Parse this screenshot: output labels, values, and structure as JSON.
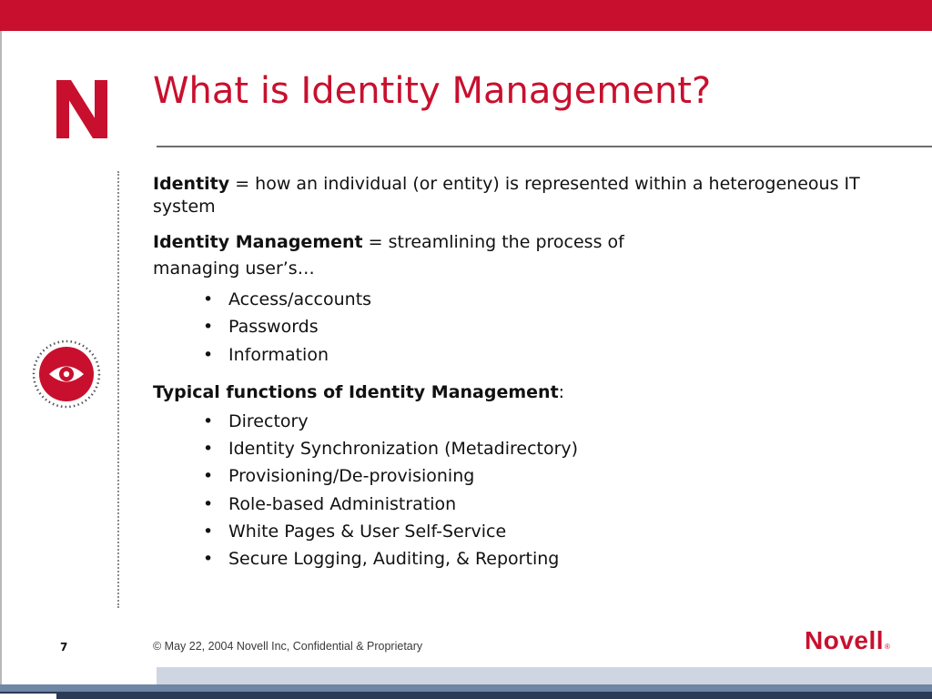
{
  "slide": {
    "title": "What is Identity Management?",
    "identity": {
      "term": "Identity",
      "definition": " = how an individual (or entity) is represented within a heterogeneous IT system"
    },
    "identity_management": {
      "term": "Identity Management",
      "definition_line1": " = streamlining the process of",
      "definition_line2": "managing user’s…",
      "items": [
        "Access/accounts",
        "Passwords",
        "Information"
      ]
    },
    "typical_functions": {
      "heading": "Typical functions of Identity Management",
      "colon": ":",
      "items": [
        "Directory",
        "Identity Synchronization (Metadirectory)",
        "Provisioning/De-provisioning",
        "Role-based Administration",
        "White Pages & User Self-Service",
        "Secure Logging, Auditing, & Reporting"
      ]
    },
    "bullet_glyph": "•"
  },
  "footer": {
    "page_number": "7",
    "copyright": "© May 22, 2004 Novell Inc, Confidential & Proprietary",
    "brand": "Novell",
    "registered_mark": "®"
  },
  "colors": {
    "brand_red": "#c8102e",
    "footer_band_light": "#cfd6e1",
    "footer_band_mid": "#6f86a5",
    "footer_band_dark": "#2b3a57"
  },
  "icons": [
    "novell-n-logo-icon",
    "eye-icon"
  ]
}
